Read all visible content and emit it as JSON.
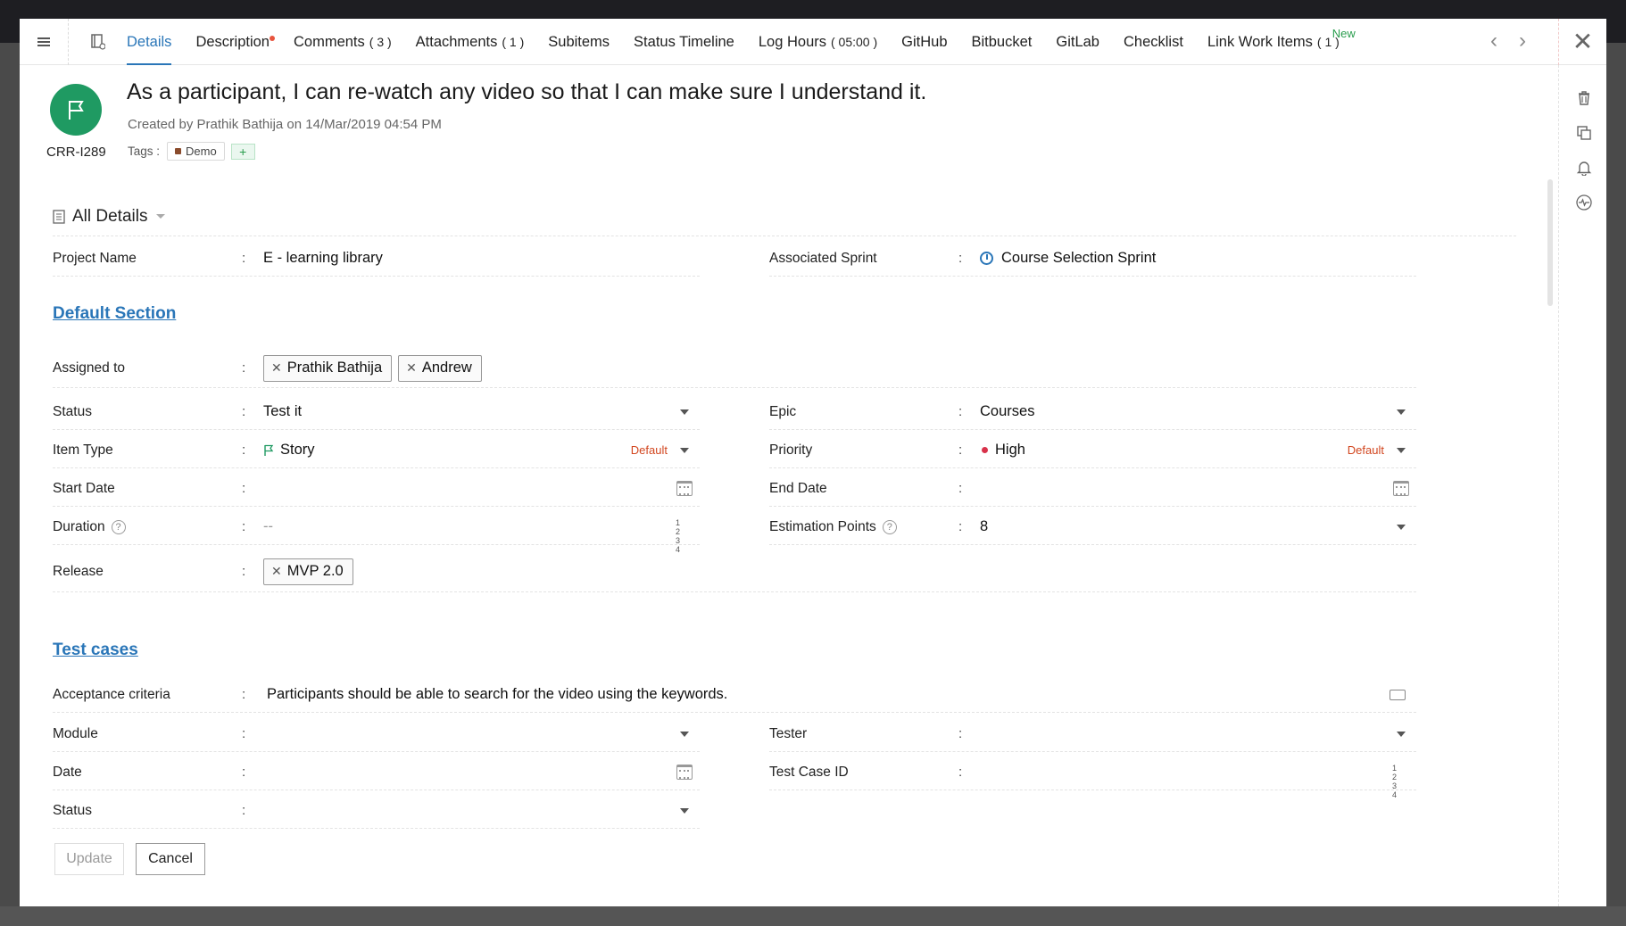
{
  "tabs": [
    {
      "label": "Details",
      "count": ""
    },
    {
      "label": "Description",
      "count": ""
    },
    {
      "label": "Comments",
      "count": "( 3 )"
    },
    {
      "label": "Attachments",
      "count": "( 1 )"
    },
    {
      "label": "Subitems",
      "count": ""
    },
    {
      "label": "Status Timeline",
      "count": ""
    },
    {
      "label": "Log Hours",
      "count": "( 05:00 )"
    },
    {
      "label": "GitHub",
      "count": ""
    },
    {
      "label": "Bitbucket",
      "count": ""
    },
    {
      "label": "GitLab",
      "count": ""
    },
    {
      "label": "Checklist",
      "count": ""
    },
    {
      "label": "Link Work Items",
      "count": "( 1 )",
      "badge": "New"
    }
  ],
  "header": {
    "item_id": "CRR-I289",
    "title": "As a participant, I can re-watch any video so that I can make sure I understand it.",
    "created": "Created by Prathik Bathija on 14/Mar/2019 04:54 PM",
    "tags_label": "Tags :",
    "tags": [
      "Demo"
    ],
    "add_tag": "+",
    "avatar_color": "#1f9a62"
  },
  "all_details": "All Details",
  "fields": {
    "project_name": {
      "label": "Project Name",
      "value": "E - learning library"
    },
    "associated_sprint": {
      "label": "Associated Sprint",
      "value": "Course Selection Sprint"
    },
    "assigned_to": {
      "label": "Assigned to",
      "values": [
        "Prathik Bathija",
        "Andrew"
      ]
    },
    "status": {
      "label": "Status",
      "value": "Test it"
    },
    "epic": {
      "label": "Epic",
      "value": "Courses"
    },
    "item_type": {
      "label": "Item Type",
      "value": "Story",
      "tag": "Default"
    },
    "priority": {
      "label": "Priority",
      "value": "High",
      "tag": "Default",
      "color": "#d8314a"
    },
    "start_date": {
      "label": "Start Date",
      "value": ""
    },
    "end_date": {
      "label": "End Date",
      "value": ""
    },
    "duration": {
      "label": "Duration",
      "value": "--"
    },
    "estimation_points": {
      "label": "Estimation Points",
      "value": "8"
    },
    "release": {
      "label": "Release",
      "values": [
        "MVP 2.0"
      ]
    }
  },
  "sections": {
    "default": "Default Section",
    "test_cases": "Test cases"
  },
  "test_fields": {
    "acceptance": {
      "label": "Acceptance criteria",
      "value": "Participants should be able to search for the video using the keywords."
    },
    "module": {
      "label": "Module",
      "value": ""
    },
    "tester": {
      "label": "Tester",
      "value": ""
    },
    "date": {
      "label": "Date",
      "value": ""
    },
    "test_case_id": {
      "label": "Test Case ID",
      "value": ""
    },
    "status": {
      "label": "Status",
      "value": ""
    }
  },
  "colon": ":",
  "num_icon": "1 2 3 4",
  "buttons": {
    "update": "Update",
    "cancel": "Cancel"
  },
  "accent": "#2a76b8"
}
